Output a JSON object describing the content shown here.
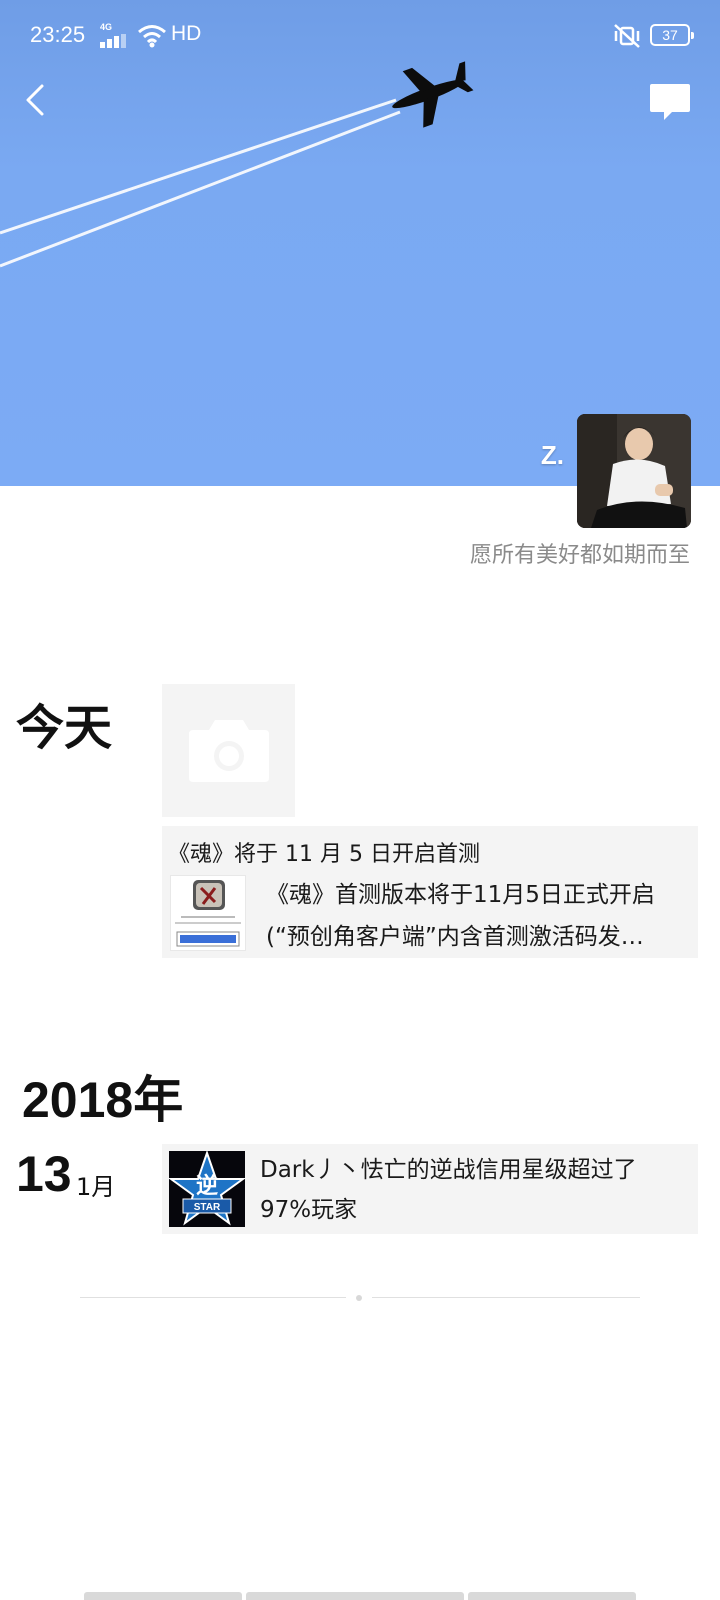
{
  "status_bar": {
    "time": "23:25",
    "network_type": "4G",
    "hd_label": "HD",
    "battery_level": "37",
    "icons": [
      "signal-icon",
      "wifi-icon",
      "vibrate-mute-icon",
      "battery-icon"
    ]
  },
  "header": {
    "icons": [
      "back-icon",
      "message-icon"
    ]
  },
  "profile": {
    "nickname": "Z.",
    "signature": "愿所有美好都如期而至"
  },
  "today": {
    "label": "今天",
    "placeholder_icon": "camera-icon",
    "shared_article": {
      "title": "《魂》将于 11 月 5 日开启首测",
      "description_line1": "《魂》首测版本将于11月5日正式开启",
      "description_line2": "(“预创角客户端”内含首测激活码发…"
    }
  },
  "archive": {
    "year_label": "2018年",
    "post": {
      "day": "13",
      "month": "1月",
      "text": "Dark丿丶怯亡的逆战信用星级超过了97%玩家",
      "thumb_badge": "STAR",
      "thumb_glyph": "逆"
    }
  },
  "colors": {
    "cover_sky": "#7aa9f2",
    "card_background": "#f4f4f4",
    "signature_text": "#8a8a8a"
  }
}
